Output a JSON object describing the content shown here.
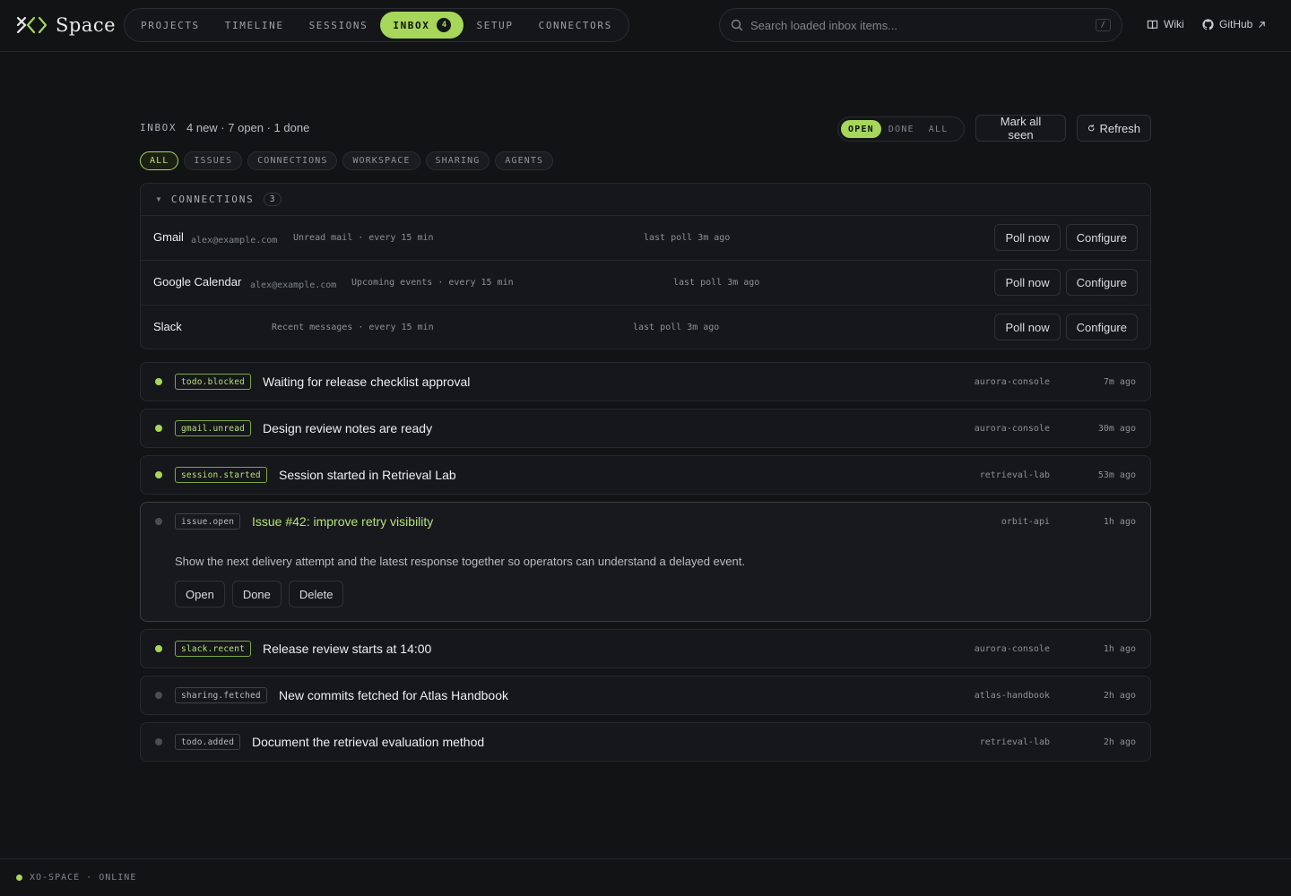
{
  "app": {
    "name": "Space",
    "logo_icon": "xo-logo-icon"
  },
  "nav": {
    "items": [
      {
        "label": "PROJECTS"
      },
      {
        "label": "TIMELINE"
      },
      {
        "label": "SESSIONS"
      },
      {
        "label": "INBOX",
        "badge": "4",
        "active": true
      },
      {
        "label": "SETUP"
      },
      {
        "label": "CONNECTORS"
      }
    ]
  },
  "search": {
    "placeholder": "Search loaded inbox items...",
    "shortcut": "/"
  },
  "links": {
    "wiki": "Wiki",
    "github": "GitHub"
  },
  "inbox": {
    "title": "INBOX",
    "stats": "4 new · 7 open · 1 done",
    "segments": [
      {
        "label": "OPEN",
        "active": true
      },
      {
        "label": "DONE"
      },
      {
        "label": "ALL"
      }
    ],
    "mark_all_seen": "Mark all seen",
    "refresh": "Refresh"
  },
  "filters": [
    {
      "label": "ALL",
      "active": true
    },
    {
      "label": "ISSUES"
    },
    {
      "label": "CONNECTIONS"
    },
    {
      "label": "WORKSPACE"
    },
    {
      "label": "SHARING"
    },
    {
      "label": "AGENTS"
    }
  ],
  "connections": {
    "title": "CONNECTIONS",
    "count": "3",
    "rows": [
      {
        "name": "Gmail",
        "account": "alex@example.com",
        "desc": "Unread mail · every 15 min",
        "poll": "last poll 3m ago",
        "poll_now": "Poll now",
        "configure": "Configure"
      },
      {
        "name": "Google Calendar",
        "account": "alex@example.com",
        "desc": "Upcoming events · every 15 min",
        "poll": "last poll 3m ago",
        "poll_now": "Poll now",
        "configure": "Configure"
      },
      {
        "name": "Slack",
        "account": "",
        "desc": "Recent messages · every 15 min",
        "poll": "last poll 3m ago",
        "poll_now": "Poll now",
        "configure": "Configure"
      }
    ]
  },
  "items": [
    {
      "tag": "todo.blocked",
      "title": "Waiting for release checklist approval",
      "project": "aurora-console",
      "time": "7m ago",
      "unread": true
    },
    {
      "tag": "gmail.unread",
      "title": "Design review notes are ready",
      "project": "aurora-console",
      "time": "30m ago",
      "unread": true
    },
    {
      "tag": "session.started",
      "title": "Session started in Retrieval Lab",
      "project": "retrieval-lab",
      "time": "53m ago",
      "unread": true
    },
    {
      "tag": "issue.open",
      "title": "Issue #42: improve retry visibility",
      "project": "orbit-api",
      "time": "1h ago",
      "unread": false,
      "body": "Show the next delivery attempt and the latest response together so operators can understand a delayed event.",
      "actions": {
        "open": "Open",
        "done": "Done",
        "delete": "Delete"
      }
    },
    {
      "tag": "slack.recent",
      "title": "Release review starts at 14:00",
      "project": "aurora-console",
      "time": "1h ago",
      "unread": true
    },
    {
      "tag": "sharing.fetched",
      "title": "New commits fetched for Atlas Handbook",
      "project": "atlas-handbook",
      "time": "2h ago",
      "unread": false
    },
    {
      "tag": "todo.added",
      "title": "Document the retrieval evaluation method",
      "project": "retrieval-lab",
      "time": "2h ago",
      "unread": false
    }
  ],
  "footer": {
    "status": "XO-SPACE · ONLINE"
  },
  "colors": {
    "accent": "#a6d65a",
    "background": "#111315",
    "panel": "#15171a"
  }
}
